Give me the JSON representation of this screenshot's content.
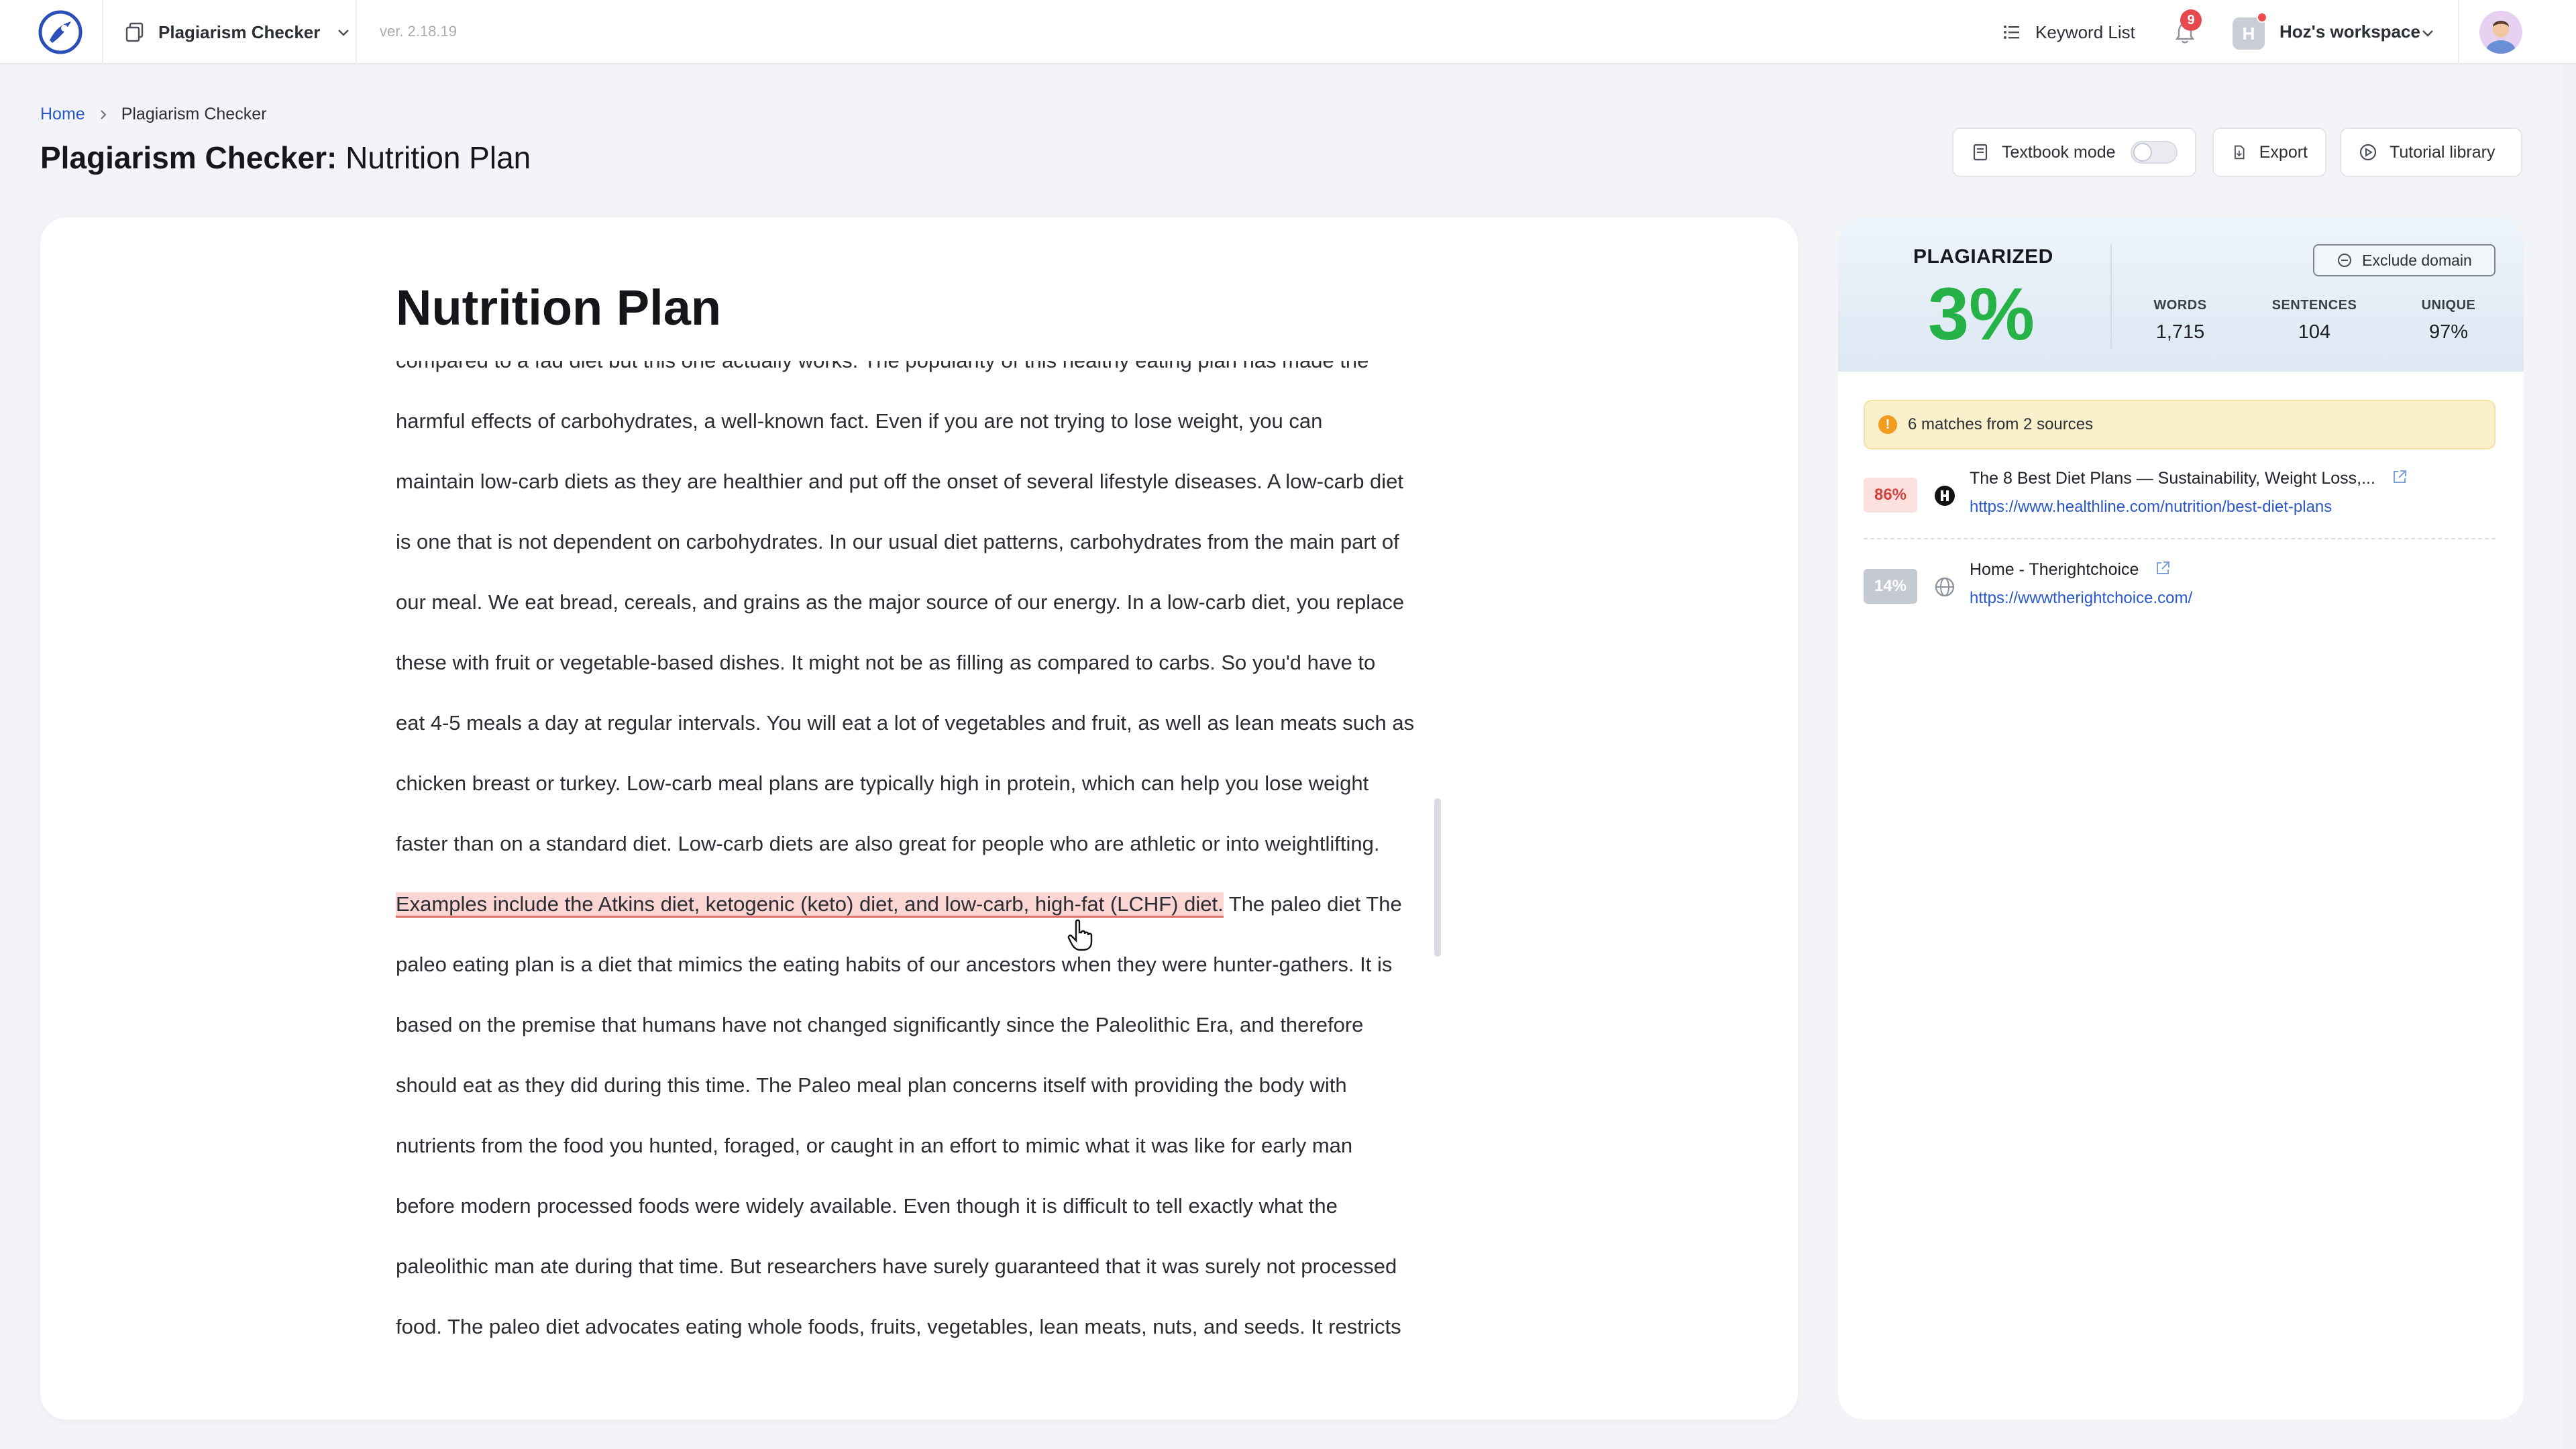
{
  "app": {
    "tool_name": "Plagiarism Checker",
    "version": "ver. 2.18.19"
  },
  "topbar": {
    "keyword_list": "Keyword List",
    "notification_count": "9",
    "workspace_initial": "H",
    "workspace_name": "Hoz's workspace"
  },
  "breadcrumb": {
    "home": "Home",
    "current": "Plagiarism Checker"
  },
  "page_title": {
    "prefix": "Plagiarism Checker:",
    "name": "Nutrition Plan"
  },
  "header_buttons": {
    "textbook_mode": "Textbook mode",
    "textbook_mode_on": false,
    "export": "Export",
    "tutorial_library": "Tutorial library"
  },
  "document": {
    "title": "Nutrition Plan",
    "lines": [
      "compared to a fad diet but this one actually works. The popularity of this healthy eating plan has made the",
      "harmful effects of carbohydrates, a well-known fact. Even if you are not trying to lose weight, you can",
      "maintain low-carb diets as they are healthier and put off the onset of several lifestyle diseases. A low-carb diet",
      "is one that is not dependent on carbohydrates. In our usual diet patterns, carbohydrates from the main part of",
      "our meal. We eat bread, cereals, and grains as the major source of our energy. In a low-carb diet, you replace",
      "these with fruit or vegetable-based dishes. It might not be as filling as compared to carbs. So you'd have to",
      "eat 4-5 meals a day at regular intervals. You will eat a lot of vegetables and fruit, as well as lean meats such as",
      "chicken breast or turkey. Low-carb meal plans are typically high in protein, which can help you lose weight",
      "faster than on a standard diet. Low-carb diets are also great for people who are athletic or into weightlifting.",
      "",
      "paleo eating plan is a diet that mimics the eating habits of our ancestors when they were hunter-gathers. It is",
      "based on the premise that humans have not changed significantly since the Paleolithic Era, and therefore",
      "should eat as they did during this time. The Paleo meal plan concerns itself with providing the body with",
      "nutrients from the food you hunted, foraged, or caught in an effort to mimic what it was like for early man",
      "before modern processed foods were widely available. Even though it is difficult to tell exactly what the",
      "paleolithic man ate during that time. But researchers have surely guaranteed that it was surely not processed",
      "food.  The paleo diet advocates eating whole foods, fruits, vegetables, lean meats, nuts, and seeds.  It restricts"
    ],
    "highlighted_sentence": "Examples include the Atkins diet, ketogenic (keto) diet, and low-carb, high-fat (LCHF) diet.",
    "after_highlight": " The paleo diet The"
  },
  "results": {
    "plagiarized_label": "PLAGIARIZED",
    "plagiarized_value": "3%",
    "exclude_domain": "Exclude domain",
    "stats": [
      {
        "label": "WORDS",
        "value": "1,715"
      },
      {
        "label": "SENTENCES",
        "value": "104"
      },
      {
        "label": "UNIQUE",
        "value": "97%"
      }
    ],
    "notice": "6 matches from 2 sources",
    "sources": [
      {
        "percent": "86%",
        "title": "The 8 Best Diet Plans — Sustainability, Weight Loss,...",
        "url": "https://www.healthline.com/nutrition/best-diet-plans"
      },
      {
        "percent": "14%",
        "title": "Home - Therightchoice",
        "url": "https://wwwtherightchoice.com/"
      }
    ]
  },
  "colors": {
    "plagiarized_green": "#27b248",
    "highlight_bg": "#fbd6d3",
    "link_blue": "#2b58c8",
    "notice_bg": "#fbf0cc",
    "source1_pct_bg": "#fbe0de",
    "source2_pct_bg": "#c5c9d2"
  }
}
